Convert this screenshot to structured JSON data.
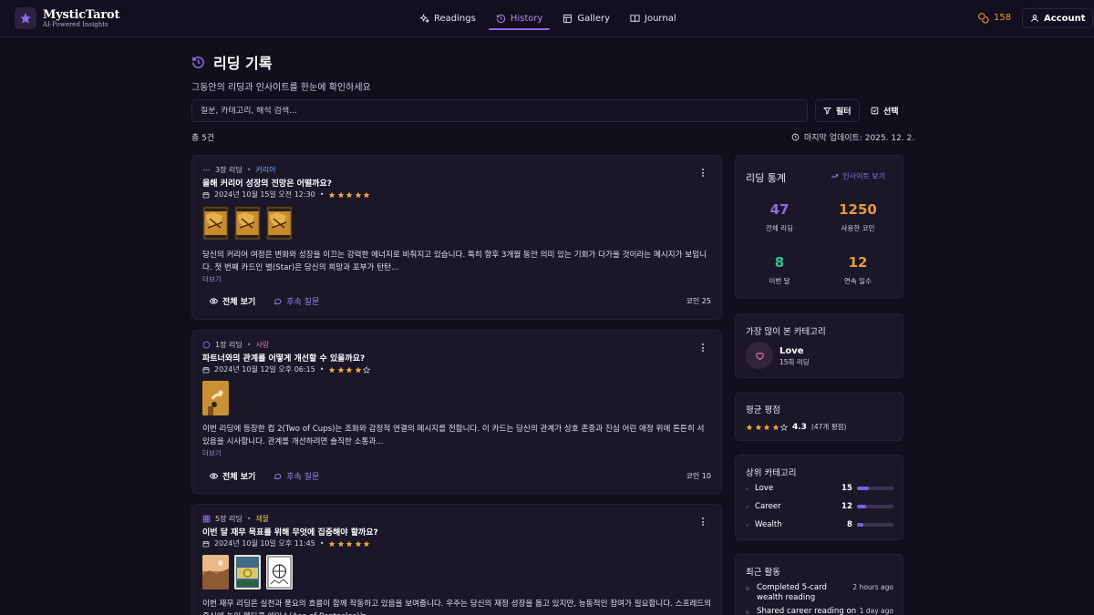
{
  "brand": {
    "name": "MysticTarot",
    "tagline": "AI-Powered Insights"
  },
  "nav": [
    {
      "label": "Readings",
      "icon": "sparkles-icon",
      "active": false
    },
    {
      "label": "History",
      "icon": "history-icon",
      "active": true
    },
    {
      "label": "Gallery",
      "icon": "gallery-icon",
      "active": false
    },
    {
      "label": "Journal",
      "icon": "book-icon",
      "active": false
    }
  ],
  "coins": "158",
  "account_label": "Account",
  "page": {
    "title": "리딩 기록",
    "subtitle": "그동안의 리딩과 인사이트를 한눈에 확인하세요"
  },
  "search": {
    "placeholder": "질문, 카테고리, 해석 검색..."
  },
  "filter_label": "필터",
  "select_label": "선택",
  "total_label": "총 5건",
  "updated_label": "마지막 업데이트: 2025. 12. 2.",
  "readings": [
    {
      "spread": "3장 리딩",
      "category": "커리어",
      "question": "올해 커리어 성장의 전망은 어떨까요?",
      "date": "2024년 10월 15일 오전 12:30",
      "rating": 5,
      "desc": "당신의 커리어 여정은 변화와 성장을 이끄는 강력한 에너지로 비춰지고 있습니다. 특히 향후 3개월 동안 의미 있는 기회가 다가올 것이라는 메시지가 보입니다. 첫 번째 카드인 별(Star)은 당신의 희망과 포부가 탄탄...",
      "more": "더보기",
      "view": "전체 보기",
      "follow": "후속 질문",
      "cost": "코인 25"
    },
    {
      "spread": "1장 리딩",
      "category": "사랑",
      "question": "파트너와의 관계를 어떻게 개선할 수 있을까요?",
      "date": "2024년 10월 12일 오후 06:15",
      "rating": 4,
      "desc": "이번 리딩에 등장한 컵 2(Two of Cups)는 조화와 감정적 연결의 메시지를 전합니다. 이 카드는 당신의 관계가 상호 존중과 진심 어린 애정 위에 튼튼히 서 있음을 시사합니다. 관계를 개선하려면 솔직한 소통과...",
      "more": "더보기",
      "view": "전체 보기",
      "follow": "후속 질문",
      "cost": "코인 10"
    },
    {
      "spread": "5장 리딩",
      "category": "재물",
      "question": "이번 달 재무 목표를 위해 무엇에 집중해야 할까요?",
      "date": "2024년 10월 10일 오후 11:45",
      "rating": 5,
      "desc": "이번 재무 리딩은 실천과 풍요의 흐름이 함께 작동하고 있음을 보여줍니다. 우주는 당신의 재정 성장을 돕고 있지만, 능동적인 참여가 필요합니다. 스프레드의 중심에 놓인 펜타클 에이스(Ace of Pentacles)는..."
    }
  ],
  "stats": {
    "title": "리딩 통계",
    "link": "인사이트 보기",
    "items": [
      {
        "value": "47",
        "label": "전체 리딩",
        "color": "#8b6ce5"
      },
      {
        "value": "1250",
        "label": "사용한 코인",
        "color": "#e39a3b"
      },
      {
        "value": "8",
        "label": "이번 달",
        "color": "#35c48c"
      },
      {
        "value": "12",
        "label": "연속 일수",
        "color": "#e39a3b"
      }
    ]
  },
  "most_viewed": {
    "title": "가장 많이 본 카테고리",
    "name": "Love",
    "count": "15회 리딩"
  },
  "avg_rating": {
    "title": "평균 평점",
    "value": "4.3",
    "rating": 4,
    "count": "(47개 평점)"
  },
  "top_categories": {
    "title": "상위 카테고리",
    "items": [
      {
        "name": "Love",
        "count": "15",
        "fill": 0.32
      },
      {
        "name": "Career",
        "count": "12",
        "fill": 0.26
      },
      {
        "name": "Wealth",
        "count": "8",
        "fill": 0.17
      }
    ]
  },
  "recent": {
    "title": "최근 활동",
    "items": [
      {
        "text": "Completed 5-card wealth reading",
        "ago": "2 hours ago"
      },
      {
        "text": "Shared career reading on",
        "ago": "1 day ago"
      }
    ]
  },
  "colors": {
    "accent": "#8b6ce5",
    "coin": "#e39a3b",
    "star": "#f0a83b"
  }
}
